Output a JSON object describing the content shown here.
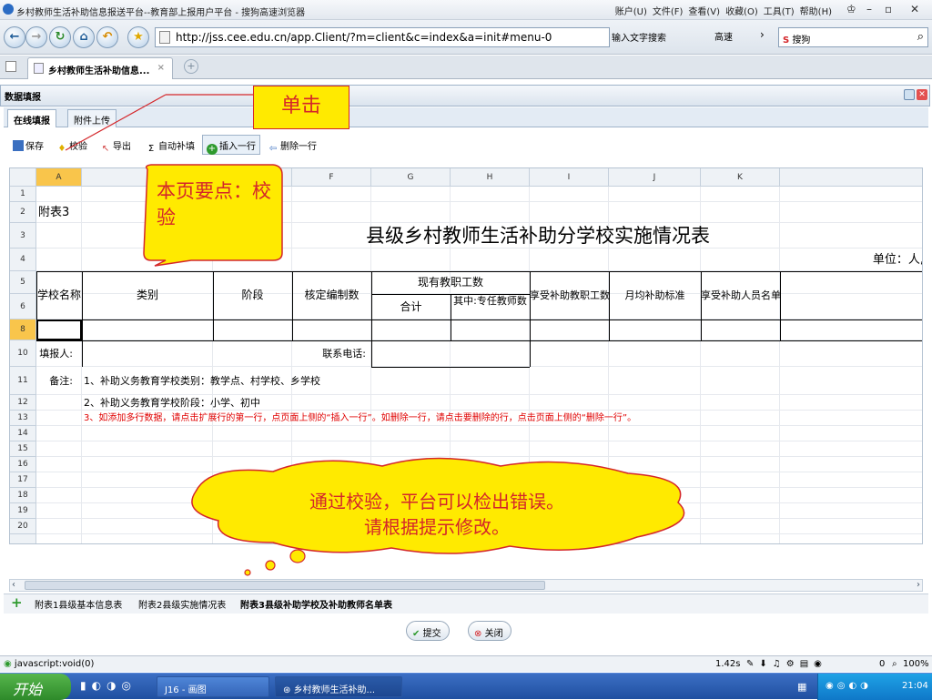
{
  "browser": {
    "title": "乡村教师生活补助信息报送平台--教育部上报用户平台 - 搜狗高速浏览器",
    "menu": [
      "账户(U)",
      "文件(F)",
      "查看(V)",
      "收藏(O)",
      "工具(T)",
      "帮助(H)"
    ],
    "url": "http://jss.cee.edu.cn/app.Client/?m=client&c=index&a=init#menu-0",
    "search_hint": "输入文字搜索",
    "speed_label": "高速",
    "search_engine": "搜狗",
    "tab_label": "乡村教师生活补助信息..."
  },
  "panel": {
    "title": "数据填报",
    "subtabs": [
      "在线填报",
      "附件上传"
    ]
  },
  "toolbar": {
    "save": "保存",
    "validate": "校验",
    "export": "导出",
    "autofill": "自动补填",
    "insert_row": "插入一行",
    "delete_row": "删除一行"
  },
  "sheet": {
    "col_headers": [
      "A",
      "",
      "E",
      "F",
      "G",
      "H",
      "I",
      "J",
      "K"
    ],
    "row_headers": [
      "1",
      "2",
      "3",
      "4",
      "5",
      "6",
      "8",
      "10",
      "11",
      "12",
      "13",
      "14",
      "15",
      "16",
      "17",
      "18",
      "19",
      "20"
    ],
    "appendix_label": "附表3",
    "table_title": "县级乡村教师生活补助分学校实施情况表",
    "unit": "单位：人,",
    "headers": {
      "school_name": "学校名称",
      "category": "类别",
      "stage": "阶段",
      "quota": "核定编制数",
      "current_staff": "现有教职工数",
      "total": "合计",
      "fulltime": "其中:专任教师数",
      "subsidized": "享受补助教职工数",
      "monthly_standard": "月均补助标准",
      "recipient_list": "享受补助人员名单"
    },
    "filler_label": "填报人:",
    "phone_label": "联系电话:",
    "notes_label": "备注:",
    "note1": "1、补助义务教育学校类别：教学点、村学校、乡学校",
    "note2": "2、补助义务教育学校阶段：小学、初中",
    "note3": "3、如添加多行数据，请点击扩展行的第一行，点页面上侧的“插入一行”。如删除一行，请点击要删除的行，点击页面上侧的“删除一行”。"
  },
  "sheet_tabs": [
    "附表1县级基本信息表",
    "附表2县级实施情况表",
    "附表3县级补助学校及补助教师名单表"
  ],
  "buttons": {
    "submit": "提交",
    "close": "关闭"
  },
  "status": {
    "left": "javascript:void(0)",
    "speed": "1.42s",
    "downloads": "0",
    "zoom": "100%"
  },
  "taskbar": {
    "start": "开始",
    "task1": "J16 - 画图",
    "task2": "乡村教师生活补助...",
    "clock": "21:04"
  },
  "annotations": {
    "click_label": "单击",
    "point_label": "本页要点：校验",
    "cloud_line1": "通过校验，平台可以检出错误。",
    "cloud_line2": "请根据提示修改。"
  },
  "colors": {
    "annotation_red": "#d4262a",
    "callout_yellow": "#ffea00",
    "note_red": "#e00000"
  }
}
